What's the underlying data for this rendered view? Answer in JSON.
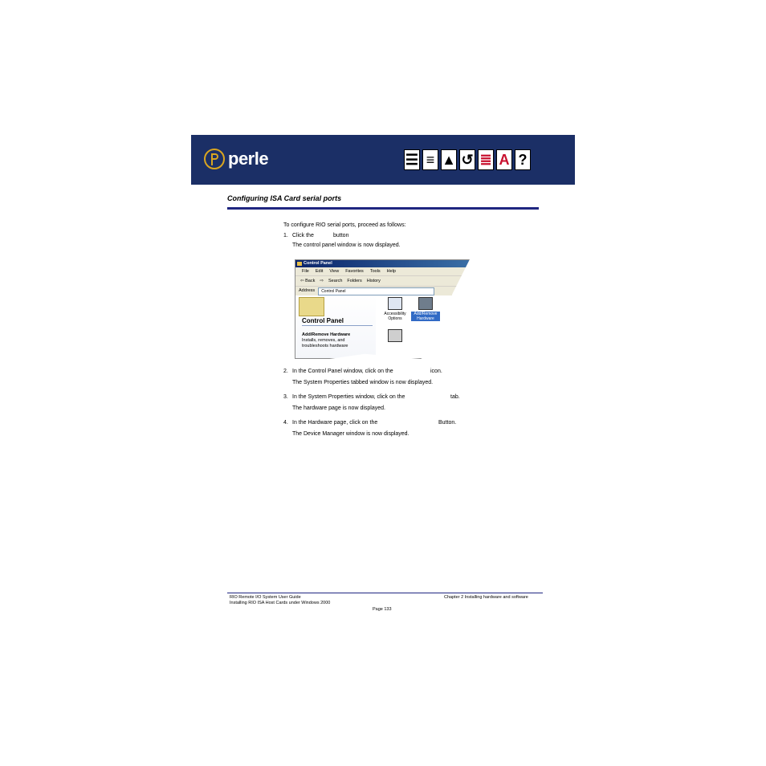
{
  "header": {
    "logo_text": "perle",
    "nav_icons": [
      "contents-icon",
      "index-icon",
      "top-icon",
      "back-icon",
      "notes-icon",
      "text-icon",
      "help-icon"
    ]
  },
  "section_title": "Configuring ISA Card serial ports",
  "intro": "To configure RIO serial ports, proceed as follows:",
  "steps": [
    {
      "num": "1.",
      "pre": "Click the",
      "post": "button",
      "result": "The control panel window is now displayed."
    },
    {
      "num": "2.",
      "pre": "In the Control Panel window, click on the",
      "post": "icon.",
      "result": "The System Properties tabbed window is now displayed."
    },
    {
      "num": "3.",
      "pre": "In the System Properties window, click on the",
      "post": "tab.",
      "result": "The hardware page is now displayed."
    },
    {
      "num": "4.",
      "pre": "In the Hardware page, click on the",
      "post": "Button.",
      "result": "The Device Manager window is now displayed."
    }
  ],
  "screenshot": {
    "title": "Control Panel",
    "menu": [
      "File",
      "Edit",
      "View",
      "Favorites",
      "Tools",
      "Help"
    ],
    "toolbar": [
      "⇦ Back",
      "⇨",
      "Search",
      "Folders",
      "History"
    ],
    "address_label": "Address",
    "address_value": "Control Panel",
    "panel_title": "Control Panel",
    "selected_name": "Add/Remove Hardware",
    "selected_desc": "Installs, removes, and troubleshoots hardware",
    "icons": [
      {
        "label": "Accessibility Options",
        "selected": false
      },
      {
        "label": "Add/Remove Hardware",
        "selected": true
      }
    ]
  },
  "footer": {
    "guide": "RIO Remote I/O System User Guide",
    "subtitle": "Installing RIO ISA Host Cards under Windows 2000",
    "chapter": "Chapter 2 Installing hardware and software",
    "page": "Page 133"
  }
}
